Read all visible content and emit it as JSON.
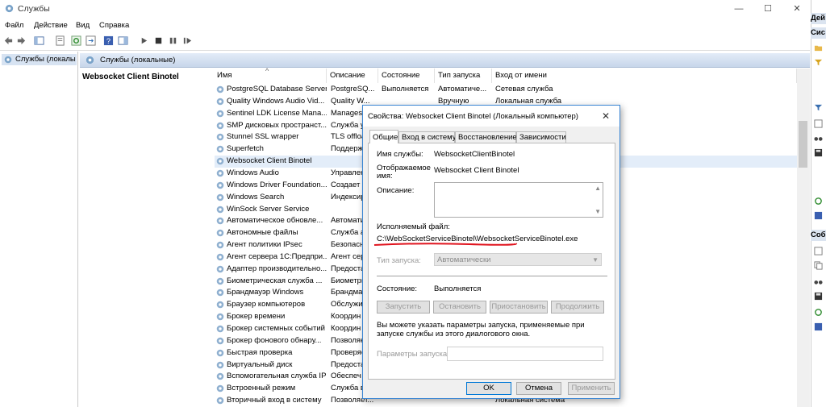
{
  "window": {
    "title": "Службы",
    "minimize": "—",
    "maximize": "☐",
    "close": "✕"
  },
  "menu": [
    "Файл",
    "Действие",
    "Вид",
    "Справка"
  ],
  "tree": {
    "item": "Службы (локалы"
  },
  "panel": {
    "header": "Службы (локальные)",
    "selected_service_title": "Websocket Client Binotel"
  },
  "columns": {
    "name": "Имя",
    "description": "Описание",
    "status": "Состояние",
    "startup": "Тип запуска",
    "logon": "Вход от имени"
  },
  "services": [
    {
      "name": "PostgreSQL Database Server...",
      "desc": "PostgreSQ...",
      "status": "Выполняется",
      "startup": "Автоматиче...",
      "logon": "Сетевая служба"
    },
    {
      "name": "Quality Windows Audio Vid...",
      "desc": "Quality W...",
      "status": "",
      "startup": "Вручную",
      "logon": "Локальная служба"
    },
    {
      "name": "Sentinel LDK License Mana...",
      "desc": "Manages...",
      "status": "",
      "startup": "",
      "logon": ""
    },
    {
      "name": "SMP дисковых пространст...",
      "desc": "Служба у",
      "status": "",
      "startup": "",
      "logon": ""
    },
    {
      "name": "Stunnel SSL wrapper",
      "desc": "TLS offloa",
      "status": "",
      "startup": "",
      "logon": ""
    },
    {
      "name": "Superfetch",
      "desc": "Поддерж",
      "status": "",
      "startup": "",
      "logon": ""
    },
    {
      "name": "Websocket Client Binotel",
      "desc": "",
      "status": "",
      "startup": "",
      "logon": ""
    },
    {
      "name": "Windows Audio",
      "desc": "Управлен",
      "status": "",
      "startup": "",
      "logon": ""
    },
    {
      "name": "Windows Driver Foundation...",
      "desc": "Создает п",
      "status": "",
      "startup": "",
      "logon": ""
    },
    {
      "name": "Windows Search",
      "desc": "Индексир",
      "status": "",
      "startup": "",
      "logon": ""
    },
    {
      "name": "WinSock Server Service",
      "desc": "",
      "status": "",
      "startup": "",
      "logon": ""
    },
    {
      "name": "Автоматическое обновле...",
      "desc": "Автомати",
      "status": "",
      "startup": "",
      "logon": ""
    },
    {
      "name": "Автономные файлы",
      "desc": "Служба а",
      "status": "",
      "startup": "",
      "logon": ""
    },
    {
      "name": "Агент политики IPsec",
      "desc": "Безопасн",
      "status": "",
      "startup": "",
      "logon": ""
    },
    {
      "name": "Агент сервера 1С:Предпри...",
      "desc": "Агент сер",
      "status": "",
      "startup": "",
      "logon": ""
    },
    {
      "name": "Адаптер производительно...",
      "desc": "Предоста",
      "status": "",
      "startup": "",
      "logon": ""
    },
    {
      "name": "Биометрическая служба ...",
      "desc": "Биометри",
      "status": "",
      "startup": "",
      "logon": ""
    },
    {
      "name": "Брандмауэр Windows",
      "desc": "Брандмау",
      "status": "",
      "startup": "",
      "logon": ""
    },
    {
      "name": "Браузер компьютеров",
      "desc": "Обслужи",
      "status": "",
      "startup": "",
      "logon": ""
    },
    {
      "name": "Брокер времени",
      "desc": "Координ",
      "status": "",
      "startup": "",
      "logon": ""
    },
    {
      "name": "Брокер системных событий",
      "desc": "Координ",
      "status": "",
      "startup": "",
      "logon": ""
    },
    {
      "name": "Брокер фонового обнару...",
      "desc": "Позволяе",
      "status": "",
      "startup": "",
      "logon": ""
    },
    {
      "name": "Быстрая проверка",
      "desc": "Проверяе",
      "status": "",
      "startup": "",
      "logon": ""
    },
    {
      "name": "Виртуальный диск",
      "desc": "Предоста",
      "status": "",
      "startup": "",
      "logon": ""
    },
    {
      "name": "Вспомогательная служба IP",
      "desc": "Обеспеч",
      "status": "",
      "startup": "",
      "logon": ""
    },
    {
      "name": "Встроенный режим",
      "desc": "Служба в",
      "status": "",
      "startup": "",
      "logon": ""
    },
    {
      "name": "Вторичный вход в систему",
      "desc": "Позволяет...",
      "status": "",
      "startup": "",
      "logon": "Локальная система"
    }
  ],
  "actions": {
    "head1": "Дей",
    "head2": "Сис",
    "head3": "Соб"
  },
  "dialog": {
    "title": "Свойства: Websocket Client Binotel (Локальный компьютер)",
    "close": "✕",
    "tabs": [
      "Общие",
      "Вход в систему",
      "Восстановление",
      "Зависимости"
    ],
    "service_name_label": "Имя службы:",
    "service_name": "WebsocketClientBinotel",
    "display_name_label": "Отображаемое имя:",
    "display_name": "Websocket Client Binotel",
    "description_label": "Описание:",
    "exe_label": "Исполняемый файл:",
    "exe_path": "C:\\WebSocketServiceBinotel\\WebsocketServiceBinotel.exe",
    "startup_type_label": "Тип запуска:",
    "startup_type": "Автоматически",
    "status_label": "Состояние:",
    "status": "Выполняется",
    "btn_start": "Запустить",
    "btn_stop": "Остановить",
    "btn_pause": "Приостановить",
    "btn_resume": "Продолжить",
    "hint": "Вы можете указать параметры запуска, применяемые при запуске службы из этого диалогового окна.",
    "params_label": "Параметры запуска:",
    "ok": "OK",
    "cancel": "Отмена",
    "apply": "Применить"
  },
  "colors": {
    "accent": "#0078d7",
    "annotation": "#e0141e",
    "panel_header": "#c7d6ea",
    "selection": "#d7e3f2"
  }
}
